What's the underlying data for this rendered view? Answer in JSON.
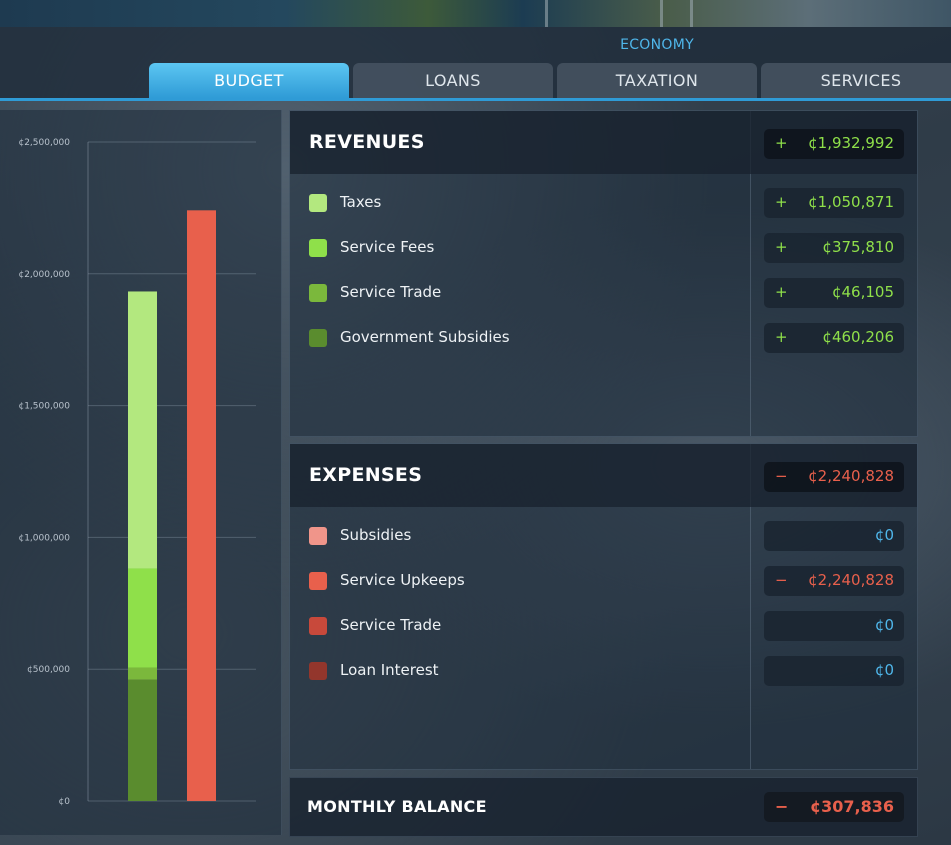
{
  "header": {
    "title": "ECONOMY"
  },
  "tabs": [
    {
      "label": "BUDGET",
      "active": true
    },
    {
      "label": "LOANS",
      "active": false
    },
    {
      "label": "TAXATION",
      "active": false
    },
    {
      "label": "SERVICES",
      "active": false
    }
  ],
  "chart_data": {
    "type": "bar",
    "stacked": true,
    "ylim": [
      0,
      2500000
    ],
    "yticks": [
      "¢2,500,000",
      "¢2,000,000",
      "¢1,500,000",
      "¢1,000,000",
      "¢500,000",
      "¢0"
    ],
    "ytick_values": [
      2500000,
      2000000,
      1500000,
      1000000,
      500000,
      0
    ],
    "categories": [
      "Revenues",
      "Expenses"
    ],
    "series": [
      {
        "values": [
          460206,
          0
        ],
        "color": "#5a8c2e"
      },
      {
        "values": [
          46105,
          0
        ],
        "color": "#7bb83c"
      },
      {
        "values": [
          375810,
          0
        ],
        "color": "#8fe04a"
      },
      {
        "values": [
          1050871,
          0
        ],
        "color": "#b3e87f"
      },
      {
        "values": [
          0,
          2240828
        ],
        "color": "#e8604c"
      }
    ]
  },
  "revenues": {
    "title": "REVENUES",
    "total_sign": "+",
    "total": "¢1,932,992",
    "items": [
      {
        "label": "Taxes",
        "sign": "+",
        "value": "¢1,050,871",
        "color": "#b3e87f"
      },
      {
        "label": "Service Fees",
        "sign": "+",
        "value": "¢375,810",
        "color": "#8fe04a"
      },
      {
        "label": "Service Trade",
        "sign": "+",
        "value": "¢46,105",
        "color": "#7bb83c"
      },
      {
        "label": "Government Subsidies",
        "sign": "+",
        "value": "¢460,206",
        "color": "#5a8c2e"
      }
    ]
  },
  "expenses": {
    "title": "EXPENSES",
    "total_sign": "−",
    "total": "¢2,240,828",
    "items": [
      {
        "label": "Subsidies",
        "sign": "",
        "value": "¢0",
        "color": "#f0958a"
      },
      {
        "label": "Service Upkeeps",
        "sign": "−",
        "value": "¢2,240,828",
        "color": "#e8604c"
      },
      {
        "label": "Service Trade",
        "sign": "",
        "value": "¢0",
        "color": "#c8493b"
      },
      {
        "label": "Loan Interest",
        "sign": "",
        "value": "¢0",
        "color": "#93362c"
      }
    ]
  },
  "balance": {
    "title": "MONTHLY BALANCE",
    "sign": "−",
    "value": "¢307,836"
  }
}
